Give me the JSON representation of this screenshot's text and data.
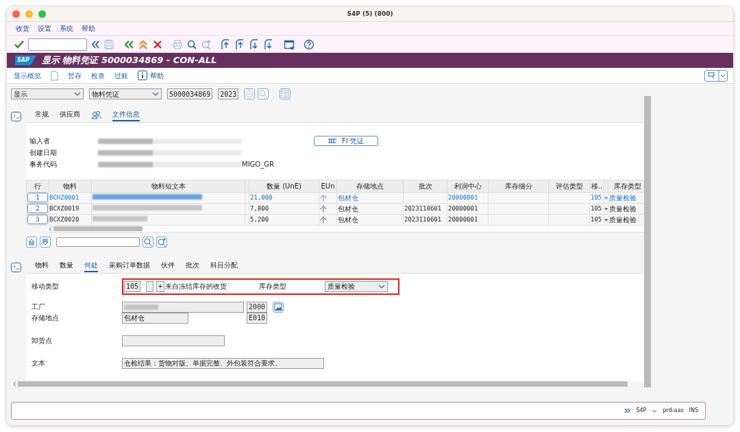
{
  "window": {
    "title": "S4P (5) (800)"
  },
  "menu": [
    "收货",
    "设置",
    "系统",
    "帮助"
  ],
  "header": {
    "logo": "SAP",
    "title": "显示 物料凭证 5000034869 - CON-ALL"
  },
  "app_toolbar": [
    {
      "kind": "link",
      "label": "显示概览"
    },
    {
      "kind": "document"
    },
    {
      "kind": "link",
      "label": "暂存"
    },
    {
      "kind": "link",
      "label": "检查"
    },
    {
      "kind": "link",
      "label": "过账"
    },
    {
      "kind": "info",
      "label": "帮助"
    }
  ],
  "selection": {
    "action": "显示",
    "doc_type": "物料凭证",
    "doc_number": "5000034869",
    "year": "2023"
  },
  "header_tabs": [
    {
      "kind": "text",
      "label": "常规",
      "selected": false
    },
    {
      "kind": "text",
      "label": "供应商",
      "selected": false
    },
    {
      "kind": "partners",
      "selected": false
    },
    {
      "kind": "text",
      "label": "文件信息",
      "selected": true
    }
  ],
  "doc_info": {
    "fields": [
      {
        "label": "输入者"
      },
      {
        "label": "创建日期"
      },
      {
        "label": "事务代码",
        "value": "MIGO_GR"
      }
    ],
    "fi_button": "FI 凭证"
  },
  "items_table": {
    "columns": [
      {
        "label": "行"
      },
      {
        "label": "物料"
      },
      {
        "label": "物料短文本"
      },
      {},
      {
        "label": "数量 (UnE)"
      },
      {
        "label": "EUn"
      },
      {
        "label": "存储地点"
      },
      {
        "label": "批次"
      },
      {
        "label": "利润中心"
      },
      {
        "label": "库存细分"
      },
      {
        "label": "评估类型"
      },
      {
        "label": "移.."
      },
      {},
      {
        "label": "库存类型"
      }
    ],
    "rows": [
      {
        "line": "1",
        "material": "BCHZ0001",
        "quantity": "21,000",
        "unit": "个",
        "storage": "包材仓",
        "batch": "",
        "profit_center": "20000001",
        "movement": "105",
        "sign": "+",
        "stock_type": "质量检验",
        "selected": true
      },
      {
        "line": "2",
        "material": "BCXZ0019",
        "quantity": "7,800",
        "unit": "个",
        "storage": "包材仓",
        "batch": "2023110601",
        "profit_center": "20000001",
        "movement": "105",
        "sign": "+",
        "stock_type": "质量检验",
        "selected": false
      },
      {
        "line": "3",
        "material": "BCXZ0020",
        "quantity": "5,200",
        "unit": "个",
        "storage": "包材仓",
        "batch": "2023110601",
        "profit_center": "20000001",
        "movement": "105",
        "sign": "+",
        "stock_type": "质量检验",
        "selected": false
      }
    ]
  },
  "item_tabs": [
    {
      "label": "物料",
      "selected": false
    },
    {
      "label": "数量",
      "selected": false
    },
    {
      "label": "何处",
      "selected": true
    },
    {
      "label": "采购订单数据",
      "selected": false
    },
    {
      "label": "伙伴",
      "selected": false
    },
    {
      "label": "批次",
      "selected": false
    },
    {
      "label": "科目分配",
      "selected": false
    }
  ],
  "where": {
    "movement_label": "移动类型",
    "movement_code": "105",
    "movement_sign": "+",
    "movement_text": "来自冻结库存的收货",
    "stock_type_label": "库存类型",
    "stock_type": "质量检验",
    "highlighted": true,
    "plant_label": "工厂",
    "plant_code": "2000",
    "storage_label": "存储地点",
    "storage_name": "包材仓",
    "storage_code": "E010",
    "unloading_label": "卸货点",
    "text_label": "文本",
    "text": "仓检结果：货物对版、单据完整、外包装符合要求。"
  },
  "status_bar": {
    "system": "S4P",
    "server": "prd-aas",
    "mode": "INS"
  }
}
